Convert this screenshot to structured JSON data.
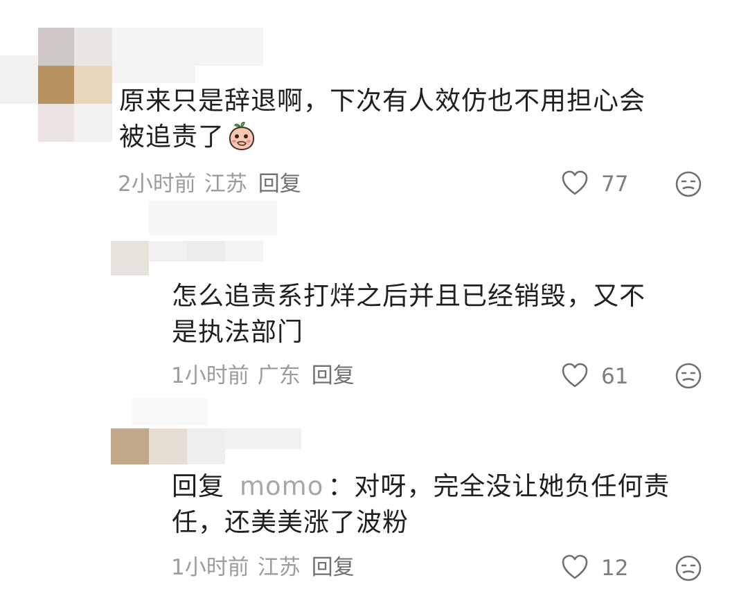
{
  "comments": [
    {
      "lines": [
        "原来只是辞退啊，下次有人效仿也不用担心会",
        "被追责了"
      ],
      "emoji": "peach-cover-mouth-emoji",
      "time": "2小时前",
      "location": "江苏",
      "reply_label": "回复",
      "likes": "77"
    },
    {
      "lines": [
        "怎么追责系打烊之后并且已经销毁，又不",
        "是执法部门"
      ],
      "time": "1小时前",
      "location": "广东",
      "reply_label": "回复",
      "likes": "61"
    },
    {
      "reply_prefix": "回复",
      "reply_to": "momo",
      "reply_colon": "：",
      "lines": [
        "对呀，完全没让她负任何责",
        "任，还美美涨了波粉"
      ],
      "time": "1小时前",
      "location": "江苏",
      "reply_label": "回复",
      "likes": "12"
    }
  ],
  "icons": {
    "like": "heart-outline-icon",
    "dislike": "neutral-face-icon"
  },
  "colors": {
    "text": "#1f1f1f",
    "meta": "#9b9ba0",
    "username": "#a7a7ab"
  }
}
